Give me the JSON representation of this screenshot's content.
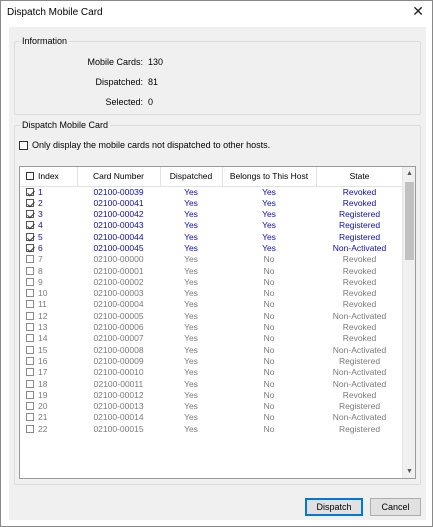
{
  "window": {
    "title": "Dispatch Mobile Card",
    "close_glyph": "✕"
  },
  "info": {
    "group_label": "Information",
    "rows": [
      {
        "label": "Mobile Cards:",
        "value": "130"
      },
      {
        "label": "Dispatched:",
        "value": "81"
      },
      {
        "label": "Selected:",
        "value": "0"
      }
    ]
  },
  "dispatch": {
    "group_label": "Dispatch Mobile Card",
    "filter_label": "Only display the mobile cards not dispatched to other hosts.",
    "filter_checked": false
  },
  "table": {
    "columns": [
      "Index",
      "Card Number",
      "Dispatched",
      "Belongs to This Host",
      "State"
    ],
    "rows": [
      {
        "index": "1",
        "card": "02100-00039",
        "dispatched": "Yes",
        "belongs": "Yes",
        "state": "Revoked",
        "checked": true
      },
      {
        "index": "2",
        "card": "02100-00041",
        "dispatched": "Yes",
        "belongs": "Yes",
        "state": "Revoked",
        "checked": true
      },
      {
        "index": "3",
        "card": "02100-00042",
        "dispatched": "Yes",
        "belongs": "Yes",
        "state": "Registered",
        "checked": true
      },
      {
        "index": "4",
        "card": "02100-00043",
        "dispatched": "Yes",
        "belongs": "Yes",
        "state": "Registered",
        "checked": true
      },
      {
        "index": "5",
        "card": "02100-00044",
        "dispatched": "Yes",
        "belongs": "Yes",
        "state": "Registered",
        "checked": true
      },
      {
        "index": "6",
        "card": "02100-00045",
        "dispatched": "Yes",
        "belongs": "Yes",
        "state": "Non-Activated",
        "checked": true
      },
      {
        "index": "7",
        "card": "02100-00000",
        "dispatched": "Yes",
        "belongs": "No",
        "state": "Revoked",
        "checked": false
      },
      {
        "index": "8",
        "card": "02100-00001",
        "dispatched": "Yes",
        "belongs": "No",
        "state": "Revoked",
        "checked": false
      },
      {
        "index": "9",
        "card": "02100-00002",
        "dispatched": "Yes",
        "belongs": "No",
        "state": "Revoked",
        "checked": false
      },
      {
        "index": "10",
        "card": "02100-00003",
        "dispatched": "Yes",
        "belongs": "No",
        "state": "Revoked",
        "checked": false
      },
      {
        "index": "11",
        "card": "02100-00004",
        "dispatched": "Yes",
        "belongs": "No",
        "state": "Revoked",
        "checked": false
      },
      {
        "index": "12",
        "card": "02100-00005",
        "dispatched": "Yes",
        "belongs": "No",
        "state": "Non-Activated",
        "checked": false
      },
      {
        "index": "13",
        "card": "02100-00006",
        "dispatched": "Yes",
        "belongs": "No",
        "state": "Revoked",
        "checked": false
      },
      {
        "index": "14",
        "card": "02100-00007",
        "dispatched": "Yes",
        "belongs": "No",
        "state": "Revoked",
        "checked": false
      },
      {
        "index": "15",
        "card": "02100-00008",
        "dispatched": "Yes",
        "belongs": "No",
        "state": "Non-Activated",
        "checked": false
      },
      {
        "index": "16",
        "card": "02100-00009",
        "dispatched": "Yes",
        "belongs": "No",
        "state": "Registered",
        "checked": false
      },
      {
        "index": "17",
        "card": "02100-00010",
        "dispatched": "Yes",
        "belongs": "No",
        "state": "Non-Activated",
        "checked": false
      },
      {
        "index": "18",
        "card": "02100-00011",
        "dispatched": "Yes",
        "belongs": "No",
        "state": "Non-Activated",
        "checked": false
      },
      {
        "index": "19",
        "card": "02100-00012",
        "dispatched": "Yes",
        "belongs": "No",
        "state": "Revoked",
        "checked": false
      },
      {
        "index": "20",
        "card": "02100-00013",
        "dispatched": "Yes",
        "belongs": "No",
        "state": "Registered",
        "checked": false
      },
      {
        "index": "21",
        "card": "02100-00014",
        "dispatched": "Yes",
        "belongs": "No",
        "state": "Non-Activated",
        "checked": false
      },
      {
        "index": "22",
        "card": "02100-00015",
        "dispatched": "Yes",
        "belongs": "No",
        "state": "Registered",
        "checked": false
      }
    ]
  },
  "scrollbar": {
    "up_glyph": "▲",
    "down_glyph": "▼"
  },
  "buttons": {
    "dispatch": "Dispatch",
    "cancel": "Cancel"
  },
  "colors": {
    "selected_text": "#1010a8",
    "unselected_text": "#7a7a7a",
    "default_button_border": "#0078d7"
  }
}
